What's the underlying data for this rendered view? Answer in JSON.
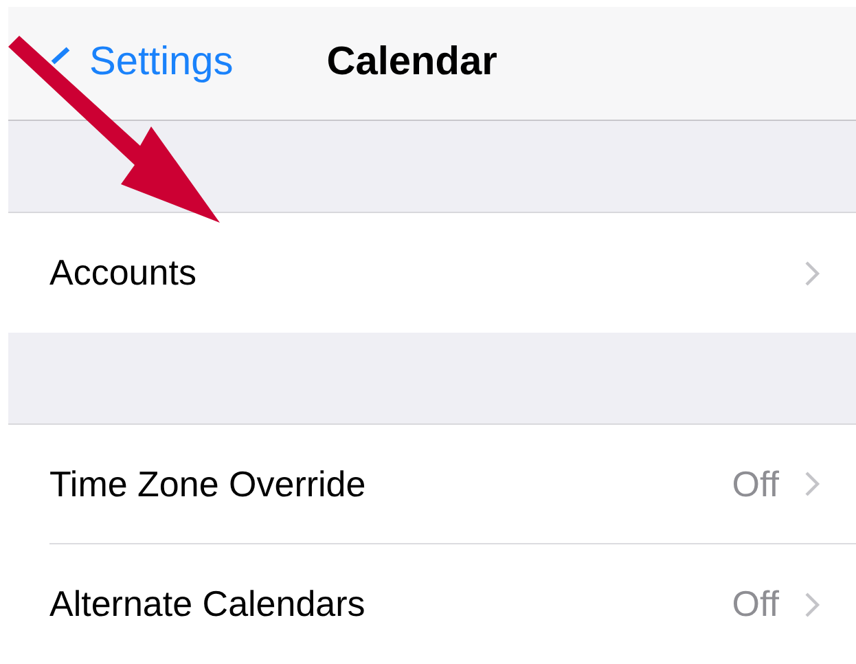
{
  "nav_bar": {
    "back_label": "Settings",
    "title": "Calendar"
  },
  "sections": [
    {
      "rows": [
        {
          "label": "Accounts"
        }
      ]
    },
    {
      "rows": [
        {
          "label": "Time Zone Override",
          "value": "Off"
        },
        {
          "label": "Alternate Calendars",
          "value": "Off"
        }
      ]
    }
  ]
}
